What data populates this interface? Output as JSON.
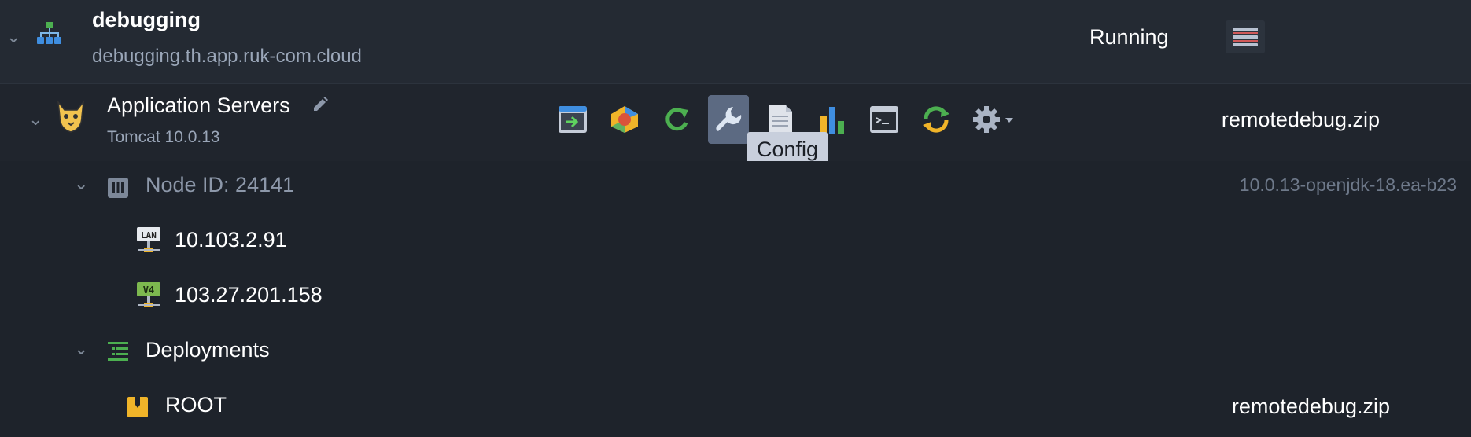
{
  "environment": {
    "name": "debugging",
    "domain": "debugging.th.app.ruk-com.cloud",
    "status": "Running",
    "icon": "environment-topology-icon"
  },
  "server_group": {
    "name": "Application Servers",
    "stack": "Tomcat 10.0.13",
    "deployment": "remotedebug.zip",
    "icon": "tomcat-icon",
    "edit_icon": "pencil-icon"
  },
  "toolbar": {
    "tools": [
      {
        "name": "open-in-browser",
        "icon": "open-in-browser-icon"
      },
      {
        "name": "add-ons",
        "icon": "addons-icon"
      },
      {
        "name": "restart",
        "icon": "restart-icon"
      },
      {
        "name": "config",
        "icon": "wrench-icon"
      },
      {
        "name": "log",
        "icon": "log-file-icon"
      },
      {
        "name": "statistics",
        "icon": "bar-chart-icon"
      },
      {
        "name": "web-ssh",
        "icon": "terminal-icon"
      },
      {
        "name": "redeploy",
        "icon": "redeploy-icon"
      },
      {
        "name": "settings",
        "icon": "gear-icon"
      }
    ],
    "tooltip": "Config"
  },
  "node": {
    "label": "Node ID: 24141",
    "version": "10.0.13-openjdk-18.ea-b23",
    "icon": "node-icon"
  },
  "ips": [
    {
      "address": "10.103.2.91",
      "type": "LAN",
      "icon": "lan-ip-icon"
    },
    {
      "address": "103.27.201.158",
      "type": "V4",
      "icon": "public-ipv4-icon"
    }
  ],
  "deployments": {
    "label": "Deployments",
    "icon": "deployments-icon",
    "items": [
      {
        "context": "ROOT",
        "archive": "remotedebug.zip",
        "icon": "archive-icon"
      }
    ]
  },
  "colors": {
    "background": "#1e232b",
    "header": "#242a33",
    "accent_green": "#4caf50",
    "active_tool": "#5c6a82",
    "tooltip": "#c8cfdc"
  }
}
